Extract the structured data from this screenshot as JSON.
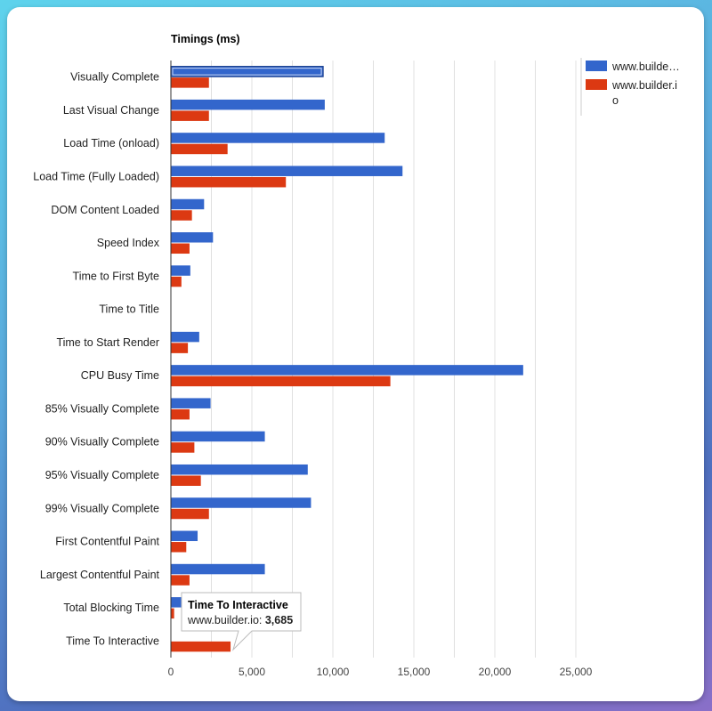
{
  "chart_data": {
    "type": "bar",
    "orientation": "horizontal",
    "title": "Timings (ms)",
    "xlabel": "",
    "ylabel": "",
    "xlim": [
      0,
      25000
    ],
    "x_ticks": [
      "0",
      "5,000",
      "10,000",
      "15,000",
      "20,000",
      "25,000"
    ],
    "x_tick_values": [
      0,
      5000,
      10000,
      15000,
      20000,
      25000
    ],
    "grid": true,
    "legend_position": "top-right",
    "categories": [
      "Visually Complete",
      "Last Visual Change",
      "Load Time (onload)",
      "Load Time (Fully Loaded)",
      "DOM Content Loaded",
      "Speed Index",
      "Time to First Byte",
      "Time to Title",
      "Time to Start Render",
      "CPU Busy Time",
      "85% Visually Complete",
      "90% Visually Complete",
      "95% Visually Complete",
      "99% Visually Complete",
      "First Contentful Paint",
      "Largest Contentful Paint",
      "Total Blocking Time",
      "Time To Interactive"
    ],
    "series": [
      {
        "name": "www.builde…",
        "color": "#3366cc",
        "values": [
          9400,
          9500,
          13200,
          14300,
          2050,
          2600,
          1200,
          20,
          1750,
          21750,
          2450,
          5800,
          8450,
          8650,
          1650,
          5800,
          650,
          0
        ]
      },
      {
        "name": "www.builder.io",
        "color": "#dc3912",
        "values": [
          2350,
          2350,
          3500,
          7100,
          1300,
          1150,
          650,
          20,
          1050,
          13550,
          1150,
          1450,
          1850,
          2350,
          950,
          1150,
          200,
          3685
        ]
      }
    ],
    "legend": [
      {
        "label": "www.builde…",
        "color": "#3366cc"
      },
      {
        "label_line1": "www.builder.i",
        "label_line2": "o",
        "color": "#dc3912"
      }
    ],
    "highlighted_bar": {
      "series": 0,
      "category": 0
    },
    "tooltip": {
      "title": "Time To Interactive",
      "series_label": "www.builder.io:",
      "value": "3,685"
    }
  }
}
